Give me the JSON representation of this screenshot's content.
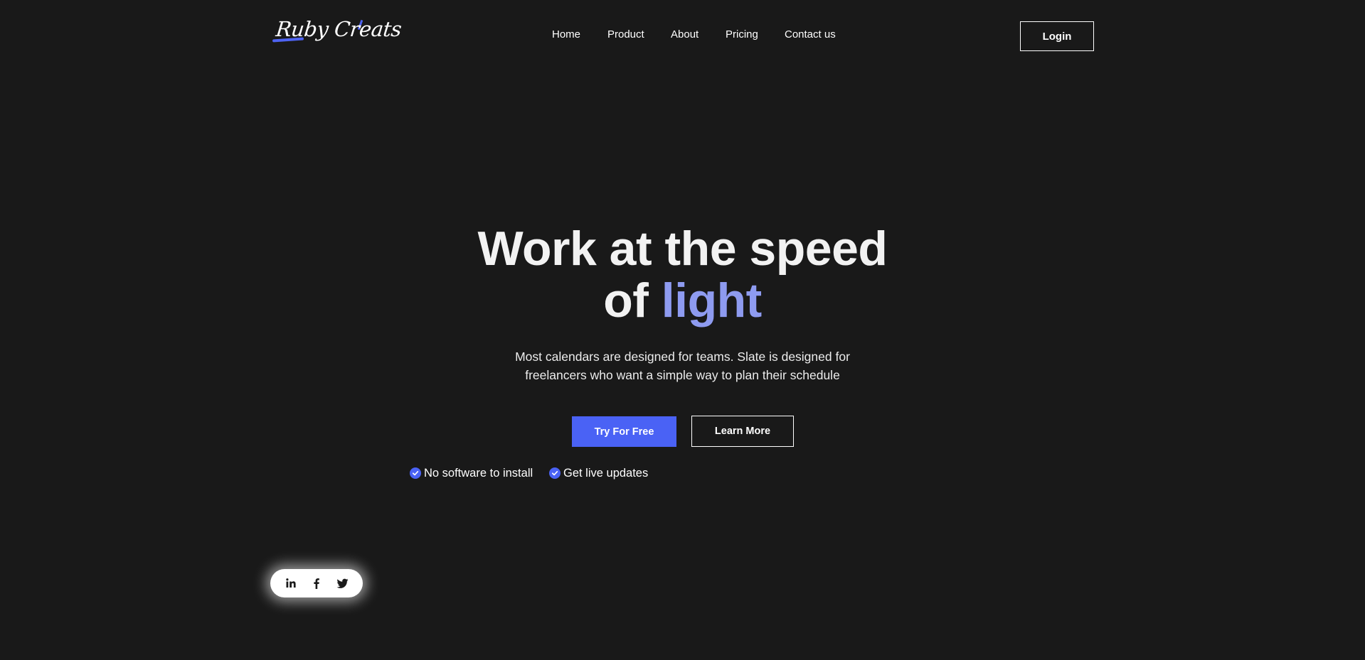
{
  "brand": {
    "logo_text": "Ruby Creats",
    "accent_color": "#4e63f2"
  },
  "nav": {
    "items": [
      {
        "label": "Home"
      },
      {
        "label": "Product"
      },
      {
        "label": "About"
      },
      {
        "label": "Pricing"
      },
      {
        "label": "Contact us"
      }
    ],
    "login_label": "Login"
  },
  "hero": {
    "title_line1": "Work at the speed",
    "title_line2_prefix": "of",
    "title_accent_word": "light",
    "subtitle_line1": "Most calendars are designed for teams. Slate is designed for",
    "subtitle_line2": "freelancers who want a simple way to plan their schedule",
    "primary_cta": "Try For Free",
    "secondary_cta": "Learn More",
    "features": [
      {
        "label": "No software to install",
        "icon": "check-circle-icon"
      },
      {
        "label": "Get live updates",
        "icon": "check-circle-icon"
      }
    ],
    "accent_text_color": "#8e9bf0",
    "primary_button_color": "#4a62f5"
  },
  "social": {
    "icons": [
      "linkedin-icon",
      "facebook-icon",
      "twitter-icon"
    ]
  },
  "colors": {
    "background": "#191919",
    "text": "#ffffff"
  }
}
